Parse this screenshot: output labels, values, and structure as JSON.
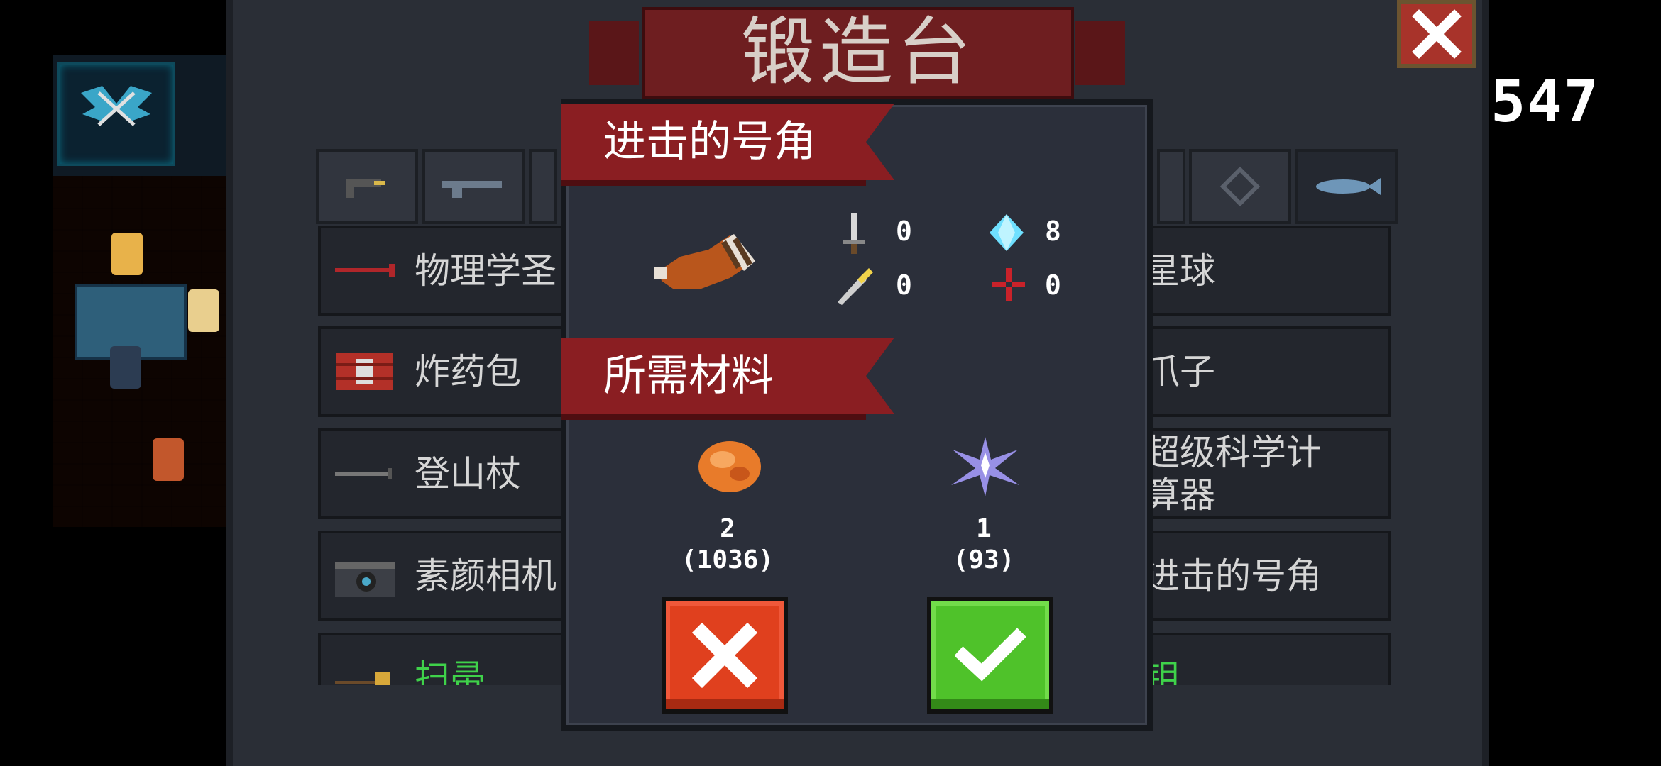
{
  "score": "547",
  "forge": {
    "title": "锻造台",
    "weapon_rows_left": [
      {
        "label": "物理学圣",
        "icon": "crowbar-icon"
      },
      {
        "label": "炸药包",
        "icon": "dynamite-icon"
      },
      {
        "label": "登山杖",
        "icon": "trekking-pole-icon"
      },
      {
        "label": "素颜相机",
        "icon": "camera-icon"
      },
      {
        "label": "扫帚",
        "icon": "broom-icon"
      }
    ],
    "weapon_rows_right": [
      {
        "label": "星球"
      },
      {
        "label": "爪子"
      },
      {
        "label": "超级科学计算器"
      },
      {
        "label": "进击的号角"
      },
      {
        "label": "钼"
      }
    ],
    "tabs": [
      "pistol-tab",
      "rifle-tab",
      "shotgun-tab",
      "blank-tab",
      "crosshair-tab",
      "fish-tab"
    ]
  },
  "dialog": {
    "weapon_name": "进击的号角",
    "weapon_icon": "horn-icon",
    "stats": {
      "damage": "0",
      "energy": "8",
      "crit": "0",
      "accuracy": "0"
    },
    "materials_title": "所需材料",
    "materials": [
      {
        "icon": "ore-icon",
        "required": "2",
        "owned": "(1036)"
      },
      {
        "icon": "crystal-shard-icon",
        "required": "1",
        "owned": "(93)"
      }
    ]
  },
  "colors": {
    "ribbon_red": "#8a1e22",
    "cancel_red": "#e0401e",
    "confirm_green": "#4fc22a",
    "list_green": "#3fd24a"
  }
}
